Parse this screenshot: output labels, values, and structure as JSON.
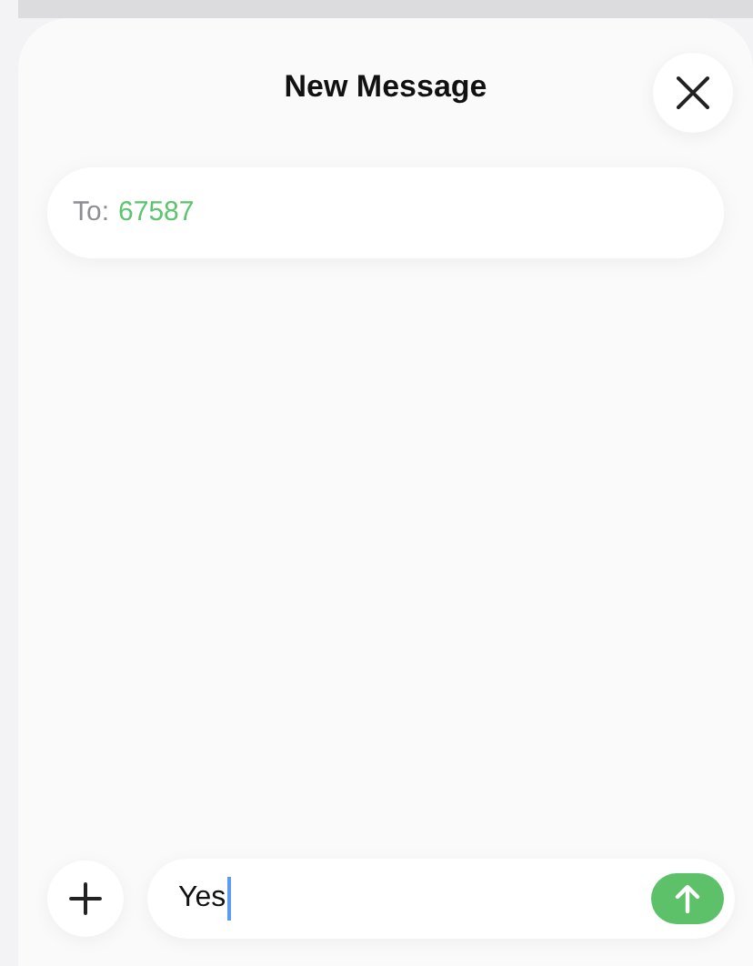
{
  "sheet": {
    "title": "New Message"
  },
  "recipient": {
    "label": "To:",
    "value": "67587"
  },
  "composer": {
    "value": "Yes"
  }
}
